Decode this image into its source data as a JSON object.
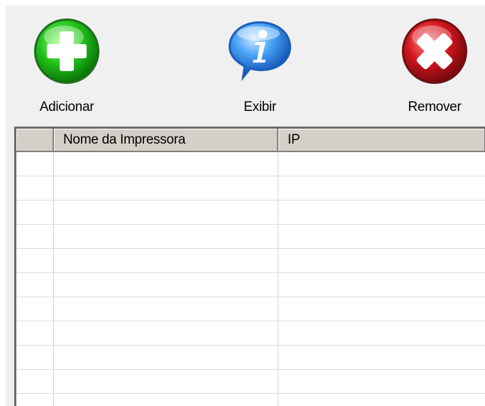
{
  "toolbar": {
    "add": {
      "label": "Adicionar",
      "icon": "plus-icon",
      "color": "#22c21a"
    },
    "view": {
      "label": "Exibir",
      "icon": "info-icon",
      "color": "#2a7fe0"
    },
    "remove": {
      "label": "Remover",
      "icon": "x-icon",
      "color": "#c8111a"
    }
  },
  "grid": {
    "columns": [
      "",
      "Nome da Impressora",
      "IP"
    ],
    "rows": [
      [
        "",
        "",
        ""
      ],
      [
        "",
        "",
        ""
      ],
      [
        "",
        "",
        ""
      ],
      [
        "",
        "",
        ""
      ],
      [
        "",
        "",
        ""
      ],
      [
        "",
        "",
        ""
      ],
      [
        "",
        "",
        ""
      ],
      [
        "",
        "",
        ""
      ],
      [
        "",
        "",
        ""
      ],
      [
        "",
        "",
        ""
      ],
      [
        "",
        "",
        ""
      ]
    ]
  }
}
